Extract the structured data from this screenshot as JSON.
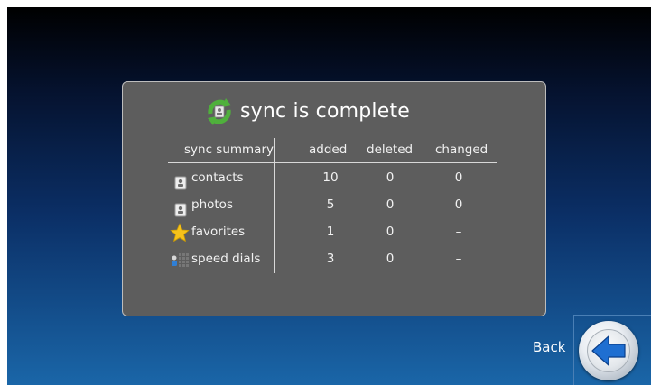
{
  "dialog": {
    "title": "sync is complete",
    "icon": "sync-icon"
  },
  "table": {
    "headers": {
      "summary": "sync summary",
      "added": "added",
      "deleted": "deleted",
      "changed": "changed"
    },
    "rows": [
      {
        "label": "contacts",
        "icon": "contact-card-icon",
        "added": "10",
        "deleted": "0",
        "changed": "0"
      },
      {
        "label": "photos",
        "icon": "photo-card-icon",
        "added": "5",
        "deleted": "0",
        "changed": "0"
      },
      {
        "label": "favorites",
        "icon": "star-icon",
        "added": "1",
        "deleted": "0",
        "changed": "–"
      },
      {
        "label": "speed dials",
        "icon": "speed-dial-icon",
        "added": "3",
        "deleted": "0",
        "changed": "–"
      }
    ]
  },
  "navigation": {
    "back_label": "Back",
    "back_icon": "left-arrow-icon"
  },
  "colors": {
    "accent_blue": "#1f6fd1",
    "star_yellow": "#f6c21a",
    "sync_green": "#4fb03c"
  }
}
